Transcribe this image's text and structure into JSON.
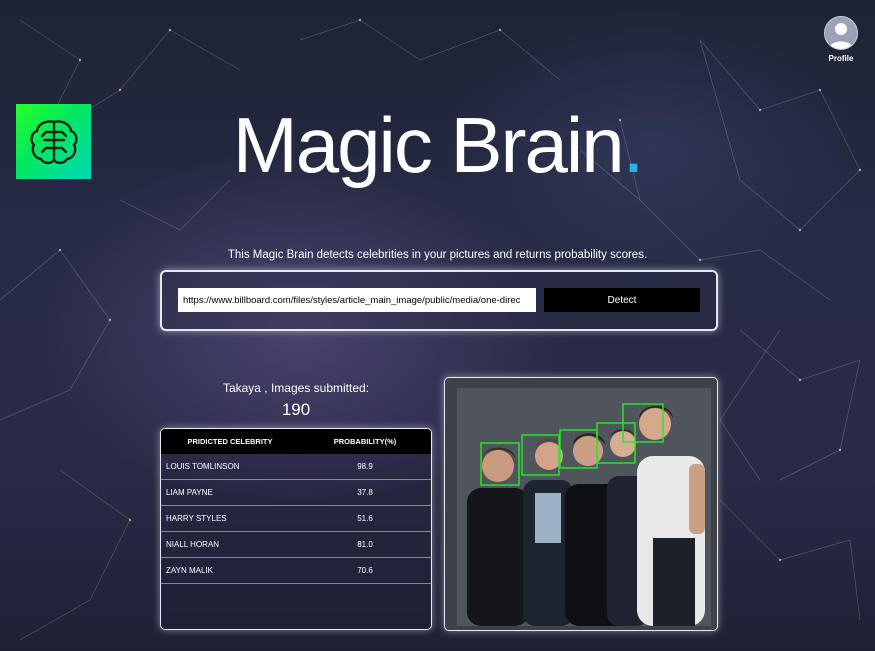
{
  "nav": {
    "profile_label": "Profile"
  },
  "header": {
    "title": "Magic Brain",
    "title_dot": "."
  },
  "tagline": "This Magic Brain detects celebrities in your pictures and returns probability scores.",
  "form": {
    "url_value": "https://www.billboard.com/files/styles/article_main_image/public/media/one-direc",
    "detect_label": "Detect"
  },
  "user": {
    "line": "Takaya , Images submitted:",
    "count": "190"
  },
  "results": {
    "headers": {
      "celebrity": "PRIDICTED CELEBRITY",
      "probability": "PROBABILITY(%)"
    },
    "rows": [
      {
        "name": "LOUIS TOMLINSON",
        "prob": "98.9"
      },
      {
        "name": "LIAM PAYNE",
        "prob": "37.8"
      },
      {
        "name": "HARRY STYLES",
        "prob": "51.6"
      },
      {
        "name": "NIALL HORAN",
        "prob": "81.0"
      },
      {
        "name": "ZAYN MALIK",
        "prob": "70.6"
      }
    ]
  },
  "colors": {
    "accent_dot": "#1fb6e8",
    "logo_green": "#2aff2a",
    "face_box": "#22ee22"
  },
  "icons": {
    "logo": "brain-icon",
    "profile": "user-avatar-icon"
  }
}
